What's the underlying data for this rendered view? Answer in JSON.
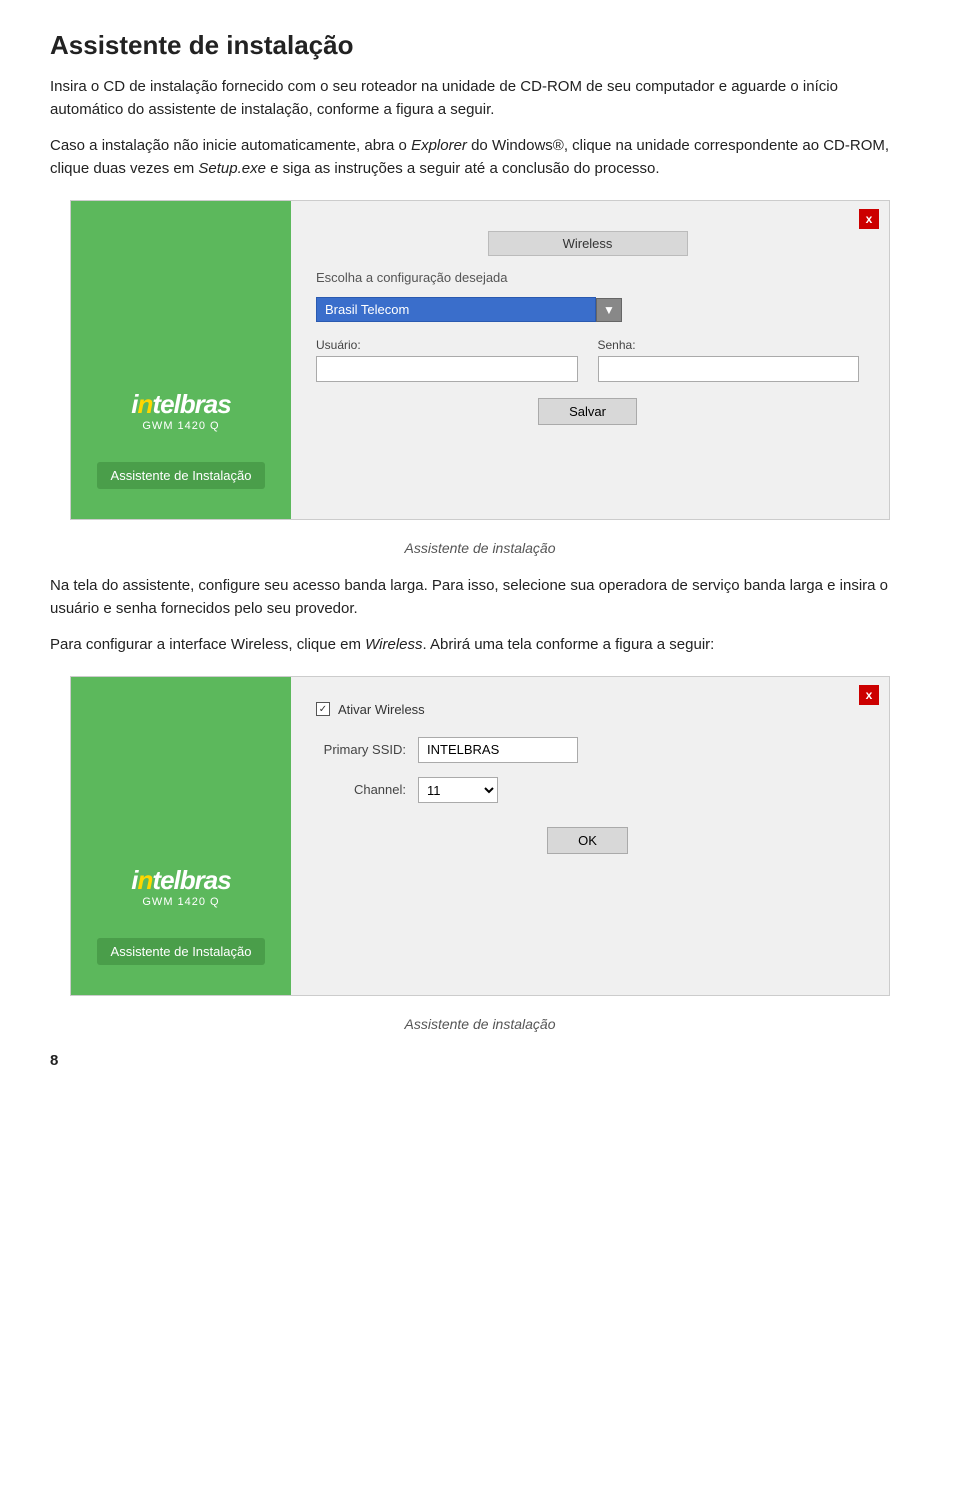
{
  "page": {
    "title": "Assistente de instalação",
    "page_number": "8"
  },
  "paragraphs": {
    "p1": "Insira o CD de instalação fornecido com o seu roteador na unidade de CD-ROM de seu computador e aguarde o início automático do assistente de instalação, conforme a figura a seguir.",
    "p2_prefix": "Caso a instalação não inicie automaticamente, abra o ",
    "p2_explorer": "Explorer",
    "p2_mid": " do Windows®, clique na unidade correspondente ao CD-ROM, clique duas vezes em ",
    "p2_setup": "Setup.exe",
    "p2_suffix": " e siga as instruções a seguir até a conclusão do processo.",
    "p3": "Na tela do assistente, configure seu acesso banda larga. Para isso, selecione sua operadora de serviço banda larga e insira o usuário e senha fornecidos pelo seu provedor.",
    "p4_prefix": "Para configurar a interface Wireless, clique em ",
    "p4_wireless": "Wireless",
    "p4_suffix": ". Abrirá uma tela conforme a figura a seguir:"
  },
  "dialog1": {
    "close_label": "x",
    "logo_text": "intelbras",
    "model_text": "GWM 1420 Q",
    "assistant_label": "Assistente de Instalação",
    "title": "Wireless",
    "subtitle": "Escolha a configuração desejada",
    "dropdown_value": "Brasil Telecom",
    "usuario_label": "Usuário:",
    "senha_label": "Senha:",
    "save_button": "Salvar",
    "caption": "Assistente de instalação"
  },
  "dialog2": {
    "close_label": "x",
    "logo_text": "intelbras",
    "model_text": "GWM 1420 Q",
    "assistant_label": "Assistente de Instalação",
    "checkbox_label": "Ativar Wireless",
    "primary_ssid_label": "Primary SSID:",
    "primary_ssid_value": "INTELBRAS",
    "channel_label": "Channel:",
    "channel_value": "11",
    "ok_button": "OK",
    "caption": "Assistente de instalação"
  }
}
